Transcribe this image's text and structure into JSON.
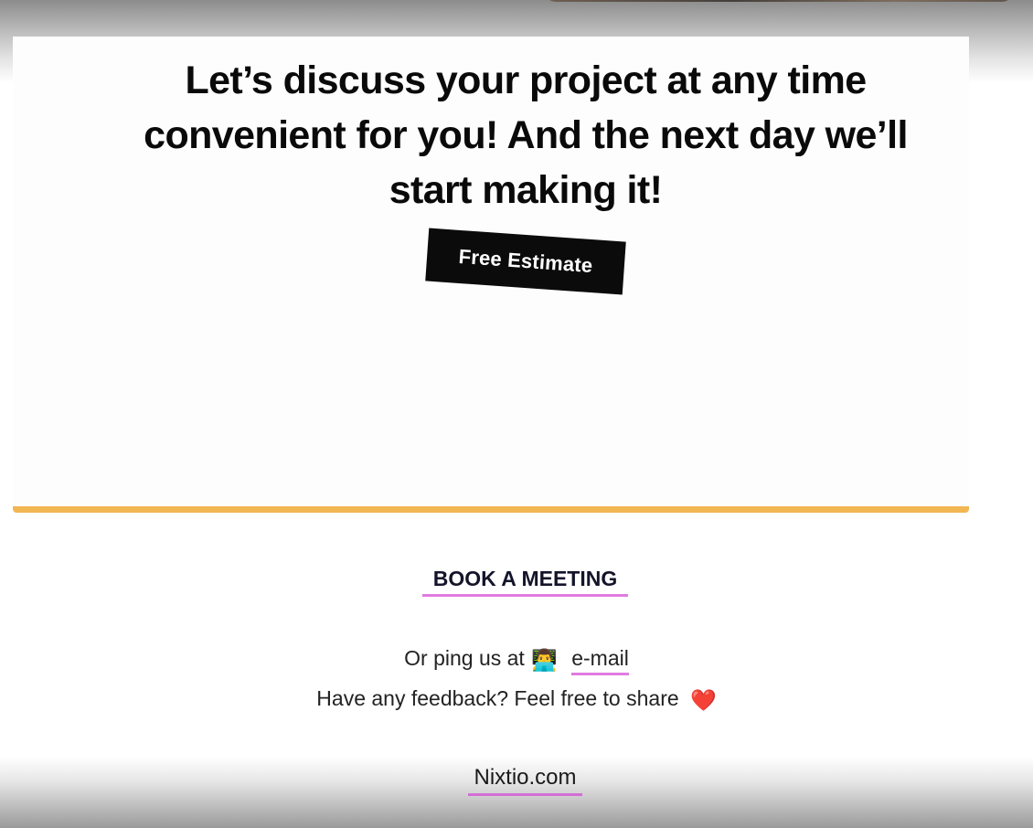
{
  "cta": {
    "headline": "Let’s discuss your project at any time convenient for you! And the next day we’ll start making it!",
    "estimate_label": "Free Estimate"
  },
  "footer": {
    "book_label": "BOOK A MEETING",
    "ping_text": "Or ping us at",
    "ping_emoji": "👨‍💻",
    "email_label": "e-mail",
    "feedback_text": "Have any feedback? Feel free to share",
    "feedback_emoji": "❤️",
    "site_label": "Nixtio.com"
  },
  "colors": {
    "accent_line": "#f2b652",
    "link_underline": "#e07be0",
    "button_bg": "#0b0b0b"
  }
}
